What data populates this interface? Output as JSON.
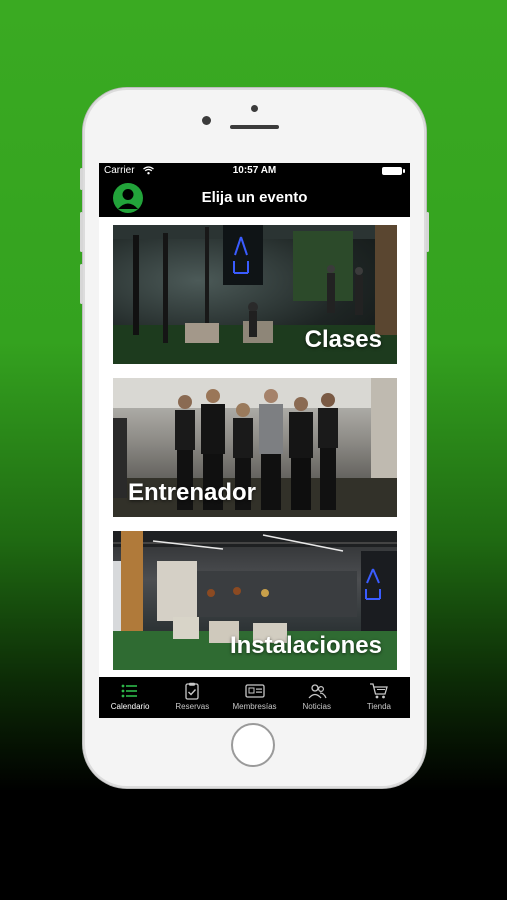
{
  "status_bar": {
    "carrier": "Carrier",
    "time": "10:57 AM"
  },
  "header": {
    "title": "Elija un evento"
  },
  "cards": [
    {
      "label": "Clases"
    },
    {
      "label": "Entrenador"
    },
    {
      "label": "Instalaciones"
    }
  ],
  "tabs": [
    {
      "label": "Calendario",
      "icon": "list-icon",
      "active": true
    },
    {
      "label": "Reservas",
      "icon": "clipboard-check-icon",
      "active": false
    },
    {
      "label": "Membresías",
      "icon": "id-card-icon",
      "active": false
    },
    {
      "label": "Noticias",
      "icon": "people-icon",
      "active": false
    },
    {
      "label": "Tienda",
      "icon": "cart-icon",
      "active": false
    }
  ],
  "colors": {
    "background_green": "#3aaa22",
    "accent_green": "#22a33a",
    "bar_black": "#000000"
  }
}
